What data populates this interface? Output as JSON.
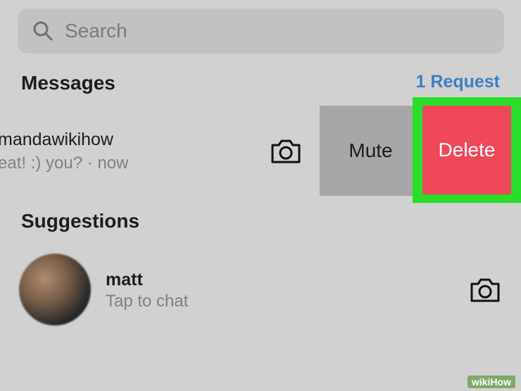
{
  "search": {
    "placeholder": "Search"
  },
  "messages": {
    "title": "Messages",
    "request_link": "1 Request",
    "thread": {
      "name": "mandawikihow",
      "preview": "eat! :) you? · now"
    },
    "swipe_actions": {
      "mute_label": "Mute",
      "delete_label": "Delete",
      "delete_color": "#ef4959",
      "highlight_color": "#2bdd2b"
    }
  },
  "suggestions": {
    "title": "Suggestions",
    "items": [
      {
        "name": "matt",
        "subtitle": "Tap to chat"
      }
    ]
  },
  "icons": [
    "search-icon",
    "camera-icon"
  ],
  "watermark": "wikiHow"
}
